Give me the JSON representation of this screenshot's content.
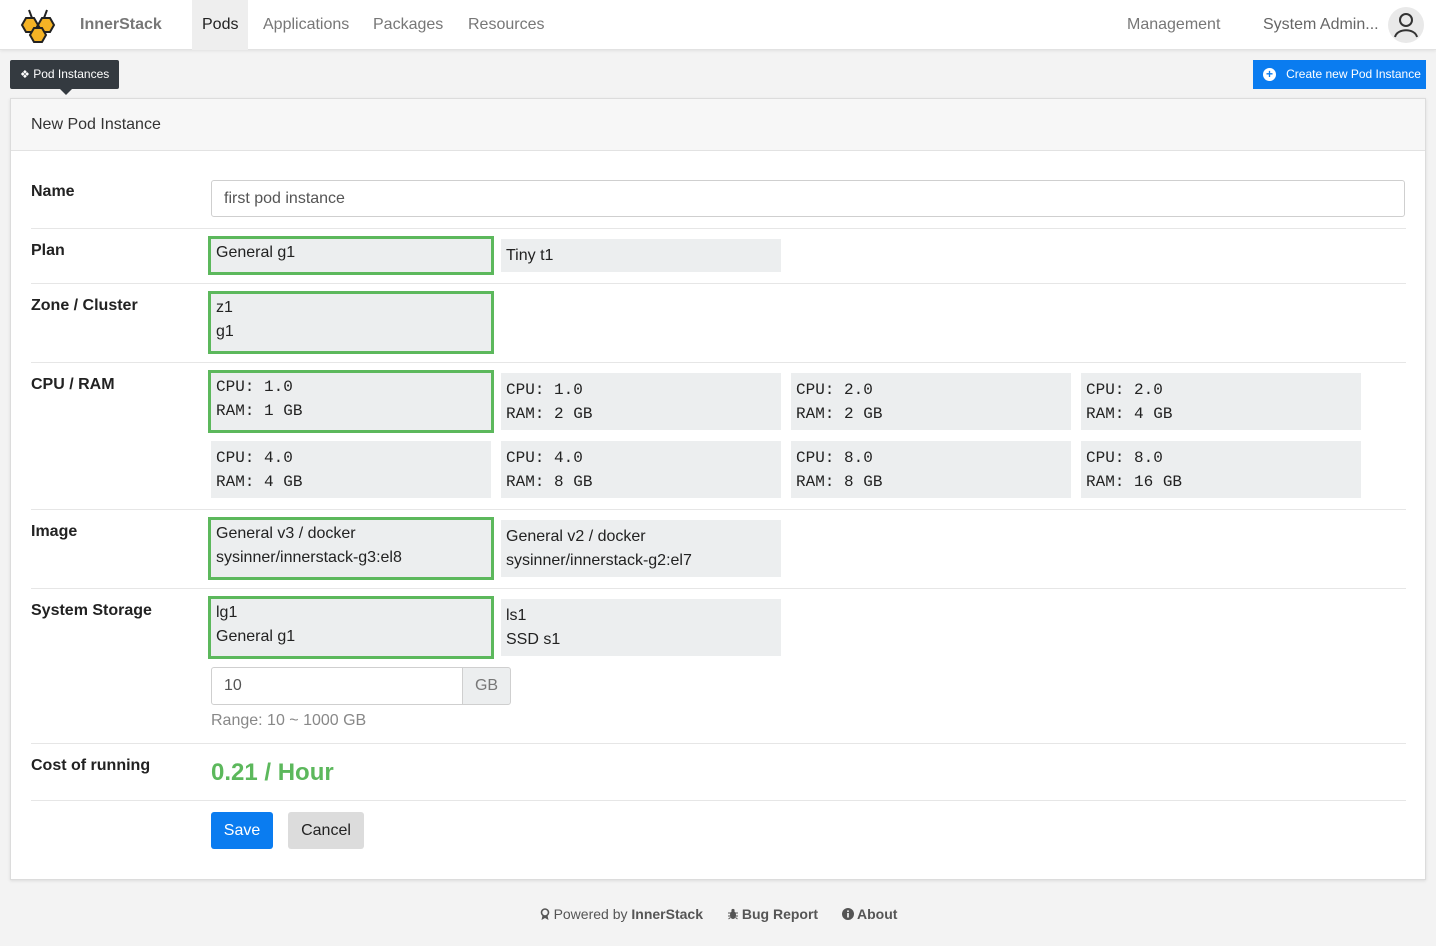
{
  "nav": {
    "brand": "InnerStack",
    "items": [
      "Pods",
      "Applications",
      "Packages",
      "Resources"
    ],
    "active": "Pods",
    "management": "Management",
    "user": "System Admin..."
  },
  "subbar": {
    "tag": "Pod Instances",
    "create_label": "Create new Pod Instance"
  },
  "card": {
    "title": "New Pod Instance",
    "labels": {
      "name": "Name",
      "plan": "Plan",
      "zone": "Zone / Cluster",
      "cpu_ram": "CPU / RAM",
      "image": "Image",
      "storage": "System Storage",
      "cost": "Cost of running"
    },
    "name_value": "first pod instance",
    "plans": [
      "General g1",
      "Tiny t1"
    ],
    "zone": {
      "line1": "z1",
      "line2": "g1"
    },
    "specs": [
      {
        "cpu": "CPU: 1.0",
        "ram": "RAM: 1 GB"
      },
      {
        "cpu": "CPU: 1.0",
        "ram": "RAM: 2 GB"
      },
      {
        "cpu": "CPU: 2.0",
        "ram": "RAM: 2 GB"
      },
      {
        "cpu": "CPU: 2.0",
        "ram": "RAM: 4 GB"
      },
      {
        "cpu": "CPU: 4.0",
        "ram": "RAM: 4 GB"
      },
      {
        "cpu": "CPU: 4.0",
        "ram": "RAM: 8 GB"
      },
      {
        "cpu": "CPU: 8.0",
        "ram": "RAM: 8 GB"
      },
      {
        "cpu": "CPU: 8.0",
        "ram": "RAM: 16 GB"
      }
    ],
    "images": [
      {
        "line1": "General v3 / docker",
        "line2": "sysinner/innerstack-g3:el8"
      },
      {
        "line1": "General v2 / docker",
        "line2": "sysinner/innerstack-g2:el7"
      }
    ],
    "storage": [
      {
        "line1": "lg1",
        "line2": "General g1"
      },
      {
        "line1": "ls1",
        "line2": "SSD s1"
      }
    ],
    "storage_size": "10",
    "storage_unit": "GB",
    "range": "Range: 10 ~ 1000 GB",
    "cost": "0.21 / Hour",
    "save": "Save",
    "cancel": "Cancel"
  },
  "footer": {
    "powered_prefix": "Powered by",
    "powered_brand": "InnerStack",
    "bug": "Bug Report",
    "about": "About"
  },
  "colors": {
    "accent": "#0a7cf0",
    "selected": "#5cb85c"
  }
}
